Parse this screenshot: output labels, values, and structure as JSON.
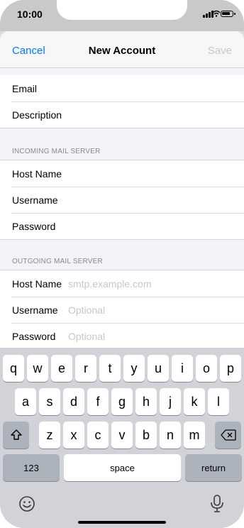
{
  "status_bar": {
    "time": "10:00"
  },
  "navbar": {
    "cancel_label": "Cancel",
    "title": "New Account",
    "save_label": "Save"
  },
  "account_fields": [
    {
      "label": "Email"
    },
    {
      "label": "Description"
    }
  ],
  "incoming": {
    "header": "INCOMING MAIL SERVER",
    "fields": [
      {
        "label": "Host Name",
        "placeholder": ""
      },
      {
        "label": "Username",
        "placeholder": ""
      },
      {
        "label": "Password",
        "placeholder": ""
      }
    ]
  },
  "outgoing": {
    "header": "OUTGOING MAIL SERVER",
    "fields": [
      {
        "label": "Host Name",
        "placeholder": "smtp.example.com"
      },
      {
        "label": "Username",
        "placeholder": "Optional"
      },
      {
        "label": "Password",
        "placeholder": "Optional"
      }
    ]
  },
  "keyboard": {
    "row1": [
      "q",
      "w",
      "e",
      "r",
      "t",
      "y",
      "u",
      "i",
      "o",
      "p"
    ],
    "row2": [
      "a",
      "s",
      "d",
      "f",
      "g",
      "h",
      "j",
      "k",
      "l"
    ],
    "row3": [
      "z",
      "x",
      "c",
      "v",
      "b",
      "n",
      "m"
    ],
    "numbers_label": "123",
    "space_label": "space",
    "return_label": "return"
  },
  "icons": {
    "shift": "shift-icon",
    "backspace": "backspace-icon",
    "emoji": "emoji-icon",
    "dictation": "microphone-icon"
  }
}
